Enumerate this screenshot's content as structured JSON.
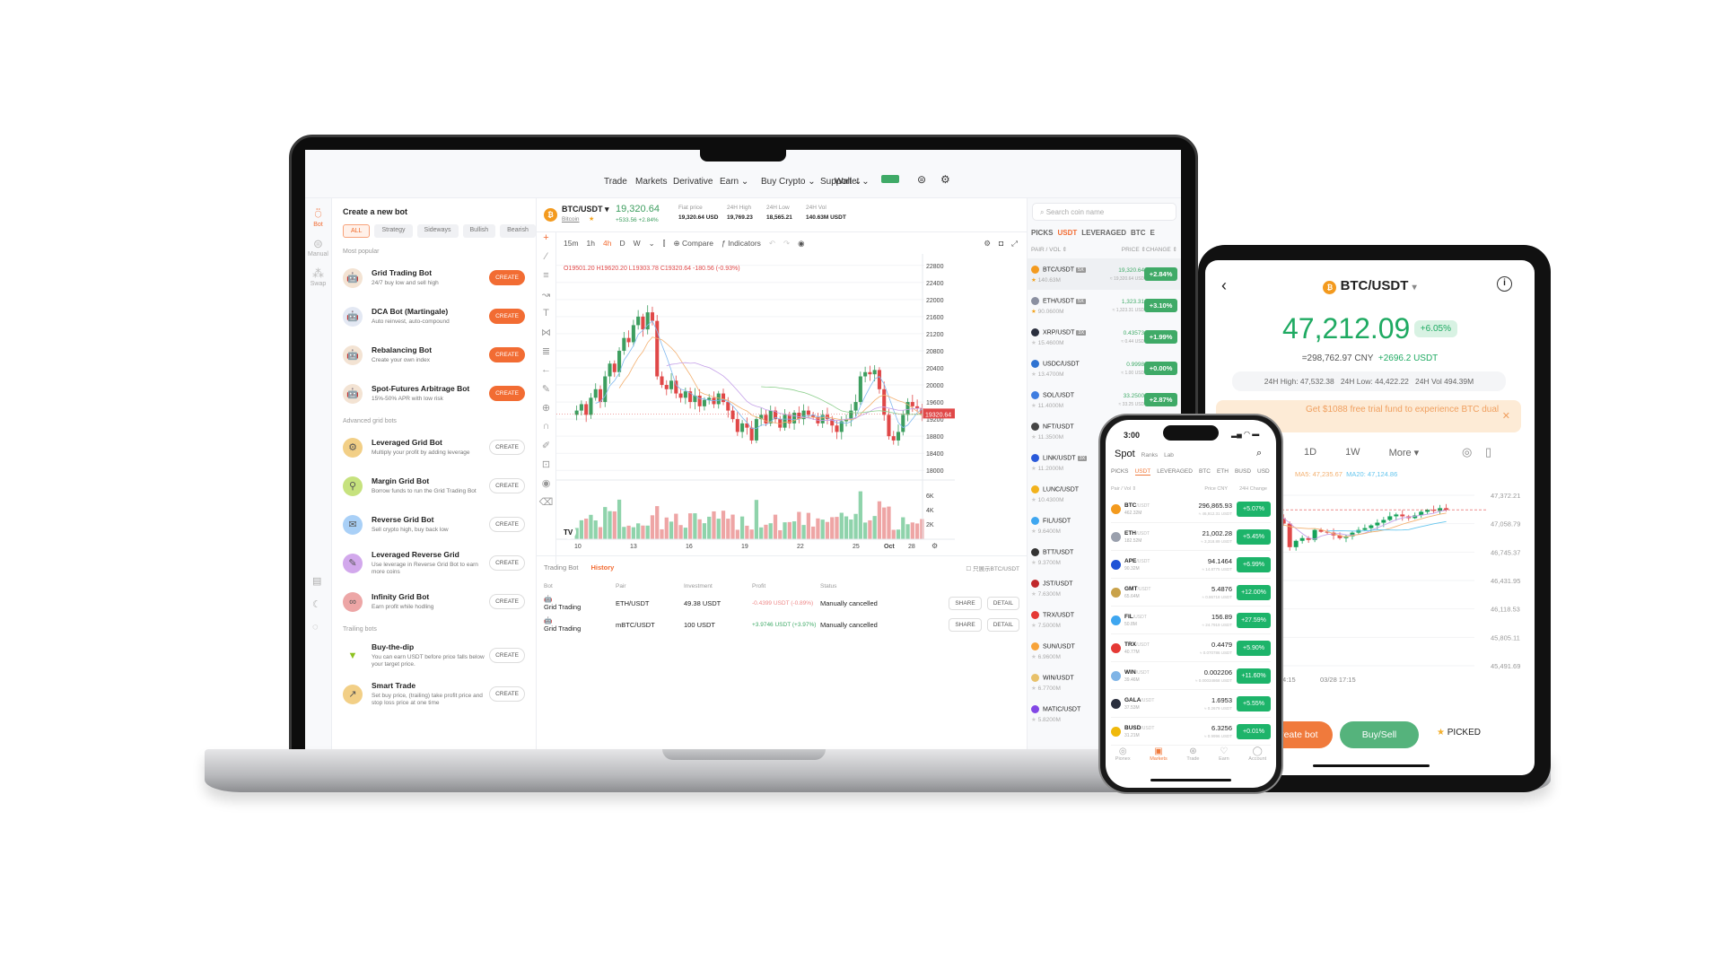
{
  "laptop": {
    "nav": [
      "Trade",
      "Markets",
      "Derivative",
      "Earn",
      "Buy Crypto",
      "Support"
    ],
    "nav_dropdown": [
      false,
      false,
      false,
      true,
      true,
      true
    ],
    "wallet": "Wallet",
    "rail": [
      {
        "label": "Bot",
        "icon": "robot-icon"
      },
      {
        "label": "Manual",
        "icon": "manual-icon"
      },
      {
        "label": "Swap",
        "icon": "swap-icon"
      }
    ],
    "bot_panel": {
      "title": "Create a new bot",
      "filters": [
        "ALL",
        "Strategy",
        "Sideways",
        "Bullish",
        "Bearish"
      ],
      "sections": [
        {
          "title": "Most popular",
          "bots": [
            {
              "name": "Grid Trading Bot",
              "desc": "24/7 buy low and sell high",
              "color": "#f3e3d3",
              "cta": "CREATE",
              "filled": true
            },
            {
              "name": "DCA Bot (Martingale)",
              "desc": "Auto reinvest, auto-compound",
              "color": "#e3e8f3",
              "cta": "CREATE",
              "filled": true
            },
            {
              "name": "Rebalancing Bot",
              "desc": "Create your own index",
              "color": "#f3e3d3",
              "cta": "CREATE",
              "filled": true
            },
            {
              "name": "Spot-Futures Arbitrage Bot",
              "desc": "15%-50% APR with low risk",
              "color": "#f3e3d3",
              "cta": "CREATE",
              "filled": true
            }
          ]
        },
        {
          "title": "Advanced grid bots",
          "bots": [
            {
              "name": "Leveraged Grid Bot",
              "desc": "Multiply your profit by adding leverage",
              "color": "#f2cf86",
              "cta": "CREATE",
              "filled": false
            },
            {
              "name": "Margin Grid Bot",
              "desc": "Borrow funds to run the Grid Trading Bot",
              "color": "#c6e27e",
              "cta": "CREATE",
              "filled": false
            },
            {
              "name": "Reverse Grid Bot",
              "desc": "Sell crypto high, buy back low",
              "color": "#a9d0f7",
              "cta": "CREATE",
              "filled": false
            },
            {
              "name": "Leveraged Reverse Grid",
              "desc": "Use leverage in Reverse Grid Bot to earn more coins",
              "color": "#d2a8ec",
              "cta": "CREATE",
              "filled": false
            },
            {
              "name": "Infinity Grid Bot",
              "desc": "Earn profit while hodling",
              "color": "#eda6a6",
              "cta": "CREATE",
              "filled": false
            }
          ]
        },
        {
          "title": "Trailing bots",
          "bots": [
            {
              "name": "Buy-the-dip",
              "desc": "You can earn USDT before price falls below your target price.",
              "color": "#ffffff",
              "cta": "CREATE",
              "filled": false
            },
            {
              "name": "Smart Trade",
              "desc": "Set buy price, (trailing) take profit price and stop loss price at one time",
              "color": "#f2cf86",
              "cta": "CREATE",
              "filled": false
            }
          ]
        }
      ]
    },
    "ticker": {
      "pair": "BTC/USDT",
      "name": "Bitcoin",
      "price": "19,320.64",
      "change": "+533.56 +2.84%",
      "stats": [
        {
          "label": "Fiat price",
          "value": "19,320.64 USD"
        },
        {
          "label": "24H High",
          "value": "19,769.23"
        },
        {
          "label": "24H Low",
          "value": "18,565.21"
        },
        {
          "label": "24H Vol",
          "value": "140.63M USDT"
        }
      ]
    },
    "toolbar": {
      "intervals": [
        "15m",
        "1h",
        "4h",
        "D",
        "W"
      ],
      "active_interval": "4h",
      "compare": "Compare",
      "indicators": "Indicators"
    },
    "chart": {
      "ohlc": "O19501.20 H19620.20 L19303.78 C19320.64 -180.56 (-0.93%)",
      "y_ticks": [
        22800,
        22400,
        22000,
        21600,
        21200,
        20800,
        20400,
        20000,
        19600,
        19200,
        18800,
        18400,
        18000
      ],
      "last_price": "19320.64",
      "vol_ticks": [
        "6K",
        "4K",
        "2K"
      ],
      "x_ticks": [
        "10",
        "13",
        "16",
        "19",
        "22",
        "25",
        "28",
        "Oct"
      ],
      "ranges": [
        "1D",
        "1W",
        "1M",
        "1Y",
        "All"
      ],
      "time": "14:21:12 (UTC+8)",
      "scale_opts": [
        "%",
        "log",
        "auto"
      ],
      "closes": [
        19400,
        19550,
        19300,
        19700,
        19900,
        19600,
        20200,
        20500,
        20300,
        20800,
        21100,
        21000,
        21400,
        21600,
        21300,
        21700,
        21500,
        20200,
        20000,
        19900,
        20100,
        19800,
        19700,
        19850,
        19600,
        19750,
        19500,
        19650,
        19700,
        19550,
        19800,
        19600,
        19400,
        19200,
        18900,
        19100,
        19000,
        18700,
        19200,
        19300,
        19100,
        19400,
        19200,
        19000,
        19300,
        19100,
        19350,
        19200,
        19400,
        19300,
        19250,
        19100,
        19300,
        19200,
        19050,
        18900,
        19150,
        19200,
        19400,
        19600,
        20200,
        20300,
        20250,
        20350,
        19900,
        19300,
        18800,
        18700,
        18900,
        19300,
        19600,
        19500,
        19450,
        19320
      ],
      "up_color": "#3d9e5f",
      "down_color": "#e04848"
    },
    "history": {
      "tabs": [
        "Trading Bot",
        "History"
      ],
      "active_tab": "History",
      "filter": "只展示BTC/USDT",
      "headers": [
        "Bot",
        "Pair",
        "Investment",
        "Profit",
        "Status"
      ],
      "rows": [
        {
          "bot": "Grid Trading",
          "pair": "ETH/USDT",
          "investment": "49.38 USDT",
          "profit": "-0.4399 USDT (-0.89%)",
          "profit_sign": "neg",
          "status": "Manually cancelled"
        },
        {
          "bot": "Grid Trading",
          "pair": "mBTC/USDT",
          "investment": "100 USDT",
          "profit": "+3.9746 USDT (+3.97%)",
          "profit_sign": "pos",
          "status": "Manually cancelled"
        }
      ],
      "share": "SHARE",
      "detail": "DETAIL"
    },
    "market": {
      "search_placeholder": "Search coin name",
      "tabs": [
        "PICKS",
        "USDT",
        "LEVERAGED",
        "BTC",
        "E"
      ],
      "active_tab": "USDT",
      "headers": [
        "PAIR / VOL",
        "PRICE",
        "CHANGE"
      ],
      "rows": [
        {
          "pair": "BTC/USDT",
          "lev": "5X",
          "vol": "140.63M",
          "price": "19,320.64",
          "fiat": "≈ 19,320.64 USD",
          "change": "+2.84%",
          "color": "#f39a1e",
          "fav": true
        },
        {
          "pair": "ETH/USDT",
          "lev": "5X",
          "vol": "90.0600M",
          "price": "1,323.31",
          "fiat": "≈ 1,323.31 USD",
          "change": "+3.10%",
          "color": "#8a8fa0",
          "fav": true
        },
        {
          "pair": "XRP/USDT",
          "lev": "3X",
          "vol": "15.4600M",
          "price": "0.43573",
          "fiat": "≈ 0.44 USD",
          "change": "+1.99%",
          "color": "#2a2f3e",
          "fav": false
        },
        {
          "pair": "USDC/USDT",
          "lev": "",
          "vol": "13.4700M",
          "price": "0.9998",
          "fiat": "≈ 1.00 USD",
          "change": "+0.00%",
          "color": "#2f73d1",
          "fav": false
        },
        {
          "pair": "SOL/USDT",
          "lev": "",
          "vol": "11.4000M",
          "price": "33.2500",
          "fiat": "≈ 33.25 USD",
          "change": "+2.87%",
          "color": "#3f7de0",
          "fav": false
        },
        {
          "pair": "NFT/USDT",
          "lev": "",
          "vol": "11.3500M",
          "price": "",
          "fiat": "",
          "change": "",
          "color": "#444",
          "fav": false
        },
        {
          "pair": "LINK/USDT",
          "lev": "3X",
          "vol": "11.2000M",
          "price": "",
          "fiat": "",
          "change": "",
          "color": "#2a5ada",
          "fav": false
        },
        {
          "pair": "LUNC/USDT",
          "lev": "",
          "vol": "10.4300M",
          "price": "",
          "fiat": "",
          "change": "",
          "color": "#f2b21c",
          "fav": false
        },
        {
          "pair": "FIL/USDT",
          "lev": "",
          "vol": "9.6400M",
          "price": "",
          "fiat": "",
          "change": "",
          "color": "#3ea6f0",
          "fav": false
        },
        {
          "pair": "BTT/USDT",
          "lev": "",
          "vol": "9.3700M",
          "price": "",
          "fiat": "",
          "change": "",
          "color": "#333",
          "fav": false
        },
        {
          "pair": "JST/USDT",
          "lev": "",
          "vol": "7.6300M",
          "price": "",
          "fiat": "",
          "change": "",
          "color": "#c0282b",
          "fav": false
        },
        {
          "pair": "TRX/USDT",
          "lev": "",
          "vol": "7.5000M",
          "price": "",
          "fiat": "",
          "change": "",
          "color": "#e53935",
          "fav": false
        },
        {
          "pair": "SUN/USDT",
          "lev": "",
          "vol": "6.9600M",
          "price": "",
          "fiat": "",
          "change": "",
          "color": "#f7a33a",
          "fav": false
        },
        {
          "pair": "WIN/USDT",
          "lev": "",
          "vol": "6.7700M",
          "price": "",
          "fiat": "",
          "change": "",
          "color": "#e8c16a",
          "fav": false
        },
        {
          "pair": "MATIC/USDT",
          "lev": "",
          "vol": "5.8200M",
          "price": "",
          "fiat": "",
          "change": "",
          "color": "#8247e5",
          "fav": false
        }
      ]
    }
  },
  "phone": {
    "time": "3:00",
    "tabs": [
      "Spot",
      "Ranks",
      "Lab"
    ],
    "markets": [
      "PICKS",
      "USDT",
      "LEVERAGED",
      "BTC",
      "ETH",
      "BUSD",
      "USD"
    ],
    "active_market": "USDT",
    "headers": [
      "Pair / Vol",
      "Price CNY",
      "24H Change"
    ],
    "rows": [
      {
        "sym": "BTC",
        "quote": "/USDT",
        "vol": "462.32M",
        "price": "296,865.93",
        "sub": "≈ 46,912.31 USDT",
        "change": "+5.07%",
        "color": "#f39a1e"
      },
      {
        "sym": "ETH",
        "quote": "/USDT",
        "vol": "182.52M",
        "price": "21,002.28",
        "sub": "≈ 3,318.89 USDT",
        "change": "+5.45%",
        "color": "#9aa0ad"
      },
      {
        "sym": "APE",
        "quote": "/USDT",
        "vol": "90.32M",
        "price": "94.1464",
        "sub": "≈ 14.8775 USDT",
        "change": "+6.99%",
        "color": "#1e53d6"
      },
      {
        "sym": "GMT",
        "quote": "/USDT",
        "vol": "65.64M",
        "price": "5.4876",
        "sub": "≈ 0.86718 USDT",
        "change": "+12.00%",
        "color": "#c9a24a"
      },
      {
        "sym": "FIL",
        "quote": "/USDT",
        "vol": "50.8M",
        "price": "156.89",
        "sub": "≈ 24.7919 USDT",
        "change": "+27.59%",
        "color": "#3ea6f0"
      },
      {
        "sym": "TRX",
        "quote": "/USDT",
        "vol": "40.77M",
        "price": "0.4479",
        "sub": "≈ 0.070786 USDT",
        "change": "+5.90%",
        "color": "#e53935"
      },
      {
        "sym": "WIN",
        "quote": "/USDT",
        "vol": "39.46M",
        "price": "0.002206",
        "sub": "≈ 0.00034868 USDT",
        "change": "+11.60%",
        "color": "#7fb4e6"
      },
      {
        "sym": "GALA",
        "quote": "/USDT",
        "vol": "37.53M",
        "price": "1.6953",
        "sub": "≈ 0.2679 USDT",
        "change": "+5.55%",
        "color": "#2a2f3e"
      },
      {
        "sym": "BUSD",
        "quote": "/USDT",
        "vol": "31.21M",
        "price": "6.3256",
        "sub": "≈ 0.9996 USDT",
        "change": "+0.01%",
        "color": "#f0b90b"
      }
    ],
    "bottom_nav": [
      "Pionex",
      "Markets",
      "Trade",
      "Earn",
      "Account"
    ],
    "active_nav": "Markets"
  },
  "tablet": {
    "pair": "BTC/USDT",
    "price": "47,212.09",
    "change": "+6.05%",
    "cny": "=298,762.97 CNY",
    "usdt_change": "+2696.2 USDT",
    "stats": "24H High: 47,532.38   24H Low: 44,422.22   24H Vol 494.39M",
    "banner": "Get $1088 free trial fund to experience BTC dual",
    "intervals": [
      "1D",
      "1W",
      "More"
    ],
    "ma": [
      "MA5: 47,235.67",
      "MA20: 47,124.86"
    ],
    "y_ticks": [
      "47,372.21",
      "47,058.79",
      "46,745.37",
      "46,431.95",
      "46,118.53",
      "45,805.11",
      "45,491.69"
    ],
    "x_ticks": [
      "03/28 11:00",
      "03/28 14:15",
      "03/28 17:15"
    ],
    "closes": [
      46900,
      46880,
      46960,
      46990,
      47000,
      46950,
      46930,
      46980,
      47080,
      47180,
      47170,
      47120,
      47060,
      46800,
      46870,
      46900,
      46880,
      46990,
      46970,
      46960,
      46930,
      46900,
      46920,
      46960,
      46990,
      47010,
      47040,
      47070,
      47100,
      47140,
      47160,
      47140,
      47120,
      47150,
      47190,
      47210,
      47200,
      47230,
      47212
    ],
    "buttons": {
      "create_bot": "Create bot",
      "buy_sell": "Buy/Sell",
      "picked": "PICKED"
    },
    "accent": "#f07a3c",
    "green": "#1faa62"
  }
}
